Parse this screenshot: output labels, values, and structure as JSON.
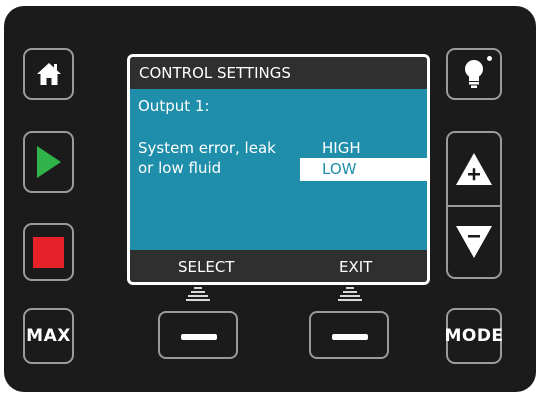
{
  "screen": {
    "title": "CONTROL SETTINGS",
    "output_label": "Output 1:",
    "setting_line1": "System error, leak",
    "setting_line2": "or low fluid",
    "options": [
      {
        "label": "HIGH",
        "selected": false
      },
      {
        "label": "LOW",
        "selected": true
      }
    ],
    "softkey_left_label": "SELECT",
    "softkey_right_label": "EXIT"
  },
  "buttons": {
    "home_icon": "home-icon",
    "play_icon": "play-icon",
    "stop_icon": "stop-icon",
    "max_label": "MAX",
    "light_icon": "lightbulb-icon",
    "plus_icon": "plus-triangle-icon",
    "minus_icon": "minus-triangle-icon",
    "mode_label": "MODE"
  },
  "colors": {
    "screen_bg": "#1e8eaa",
    "play_green": "#2fb34a",
    "stop_red": "#e62129",
    "panel_bg": "#1b1b1b"
  }
}
